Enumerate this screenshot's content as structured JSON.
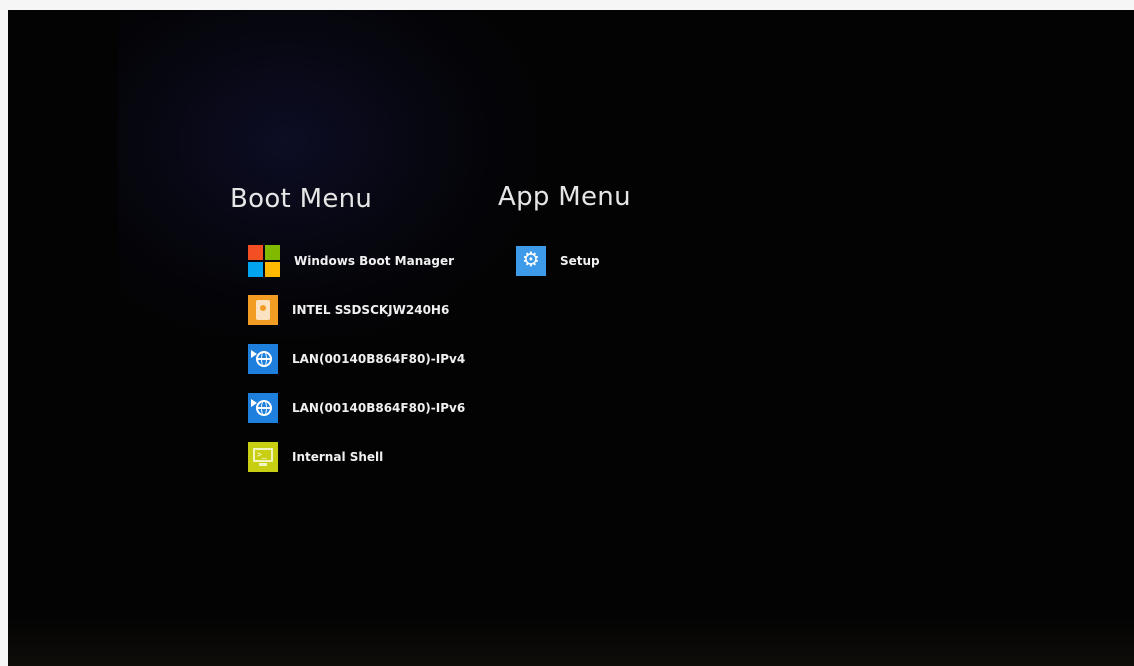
{
  "boot_menu": {
    "title": "Boot Menu",
    "items": [
      {
        "label": "Windows Boot Manager",
        "icon": "windows-logo-icon"
      },
      {
        "label": "INTEL SSDSCKJW240H6",
        "icon": "disk-icon"
      },
      {
        "label": "LAN(00140B864F80)-IPv4",
        "icon": "network-globe-icon"
      },
      {
        "label": "LAN(00140B864F80)-IPv6",
        "icon": "network-globe-icon"
      },
      {
        "label": "Internal Shell",
        "icon": "shell-monitor-icon"
      }
    ]
  },
  "app_menu": {
    "title": "App Menu",
    "items": [
      {
        "label": "Setup",
        "icon": "gear-icon"
      }
    ]
  },
  "colors": {
    "background": "#030303",
    "text": "#f0f0f0",
    "windows_red": "#f25022",
    "windows_green": "#7fba00",
    "windows_blue": "#00a4ef",
    "windows_yellow": "#ffb900",
    "disk_orange": "#f39c23",
    "lan_blue": "#1f7fdd",
    "shell_yellow": "#c8cf13",
    "setup_blue": "#3d9be9"
  }
}
